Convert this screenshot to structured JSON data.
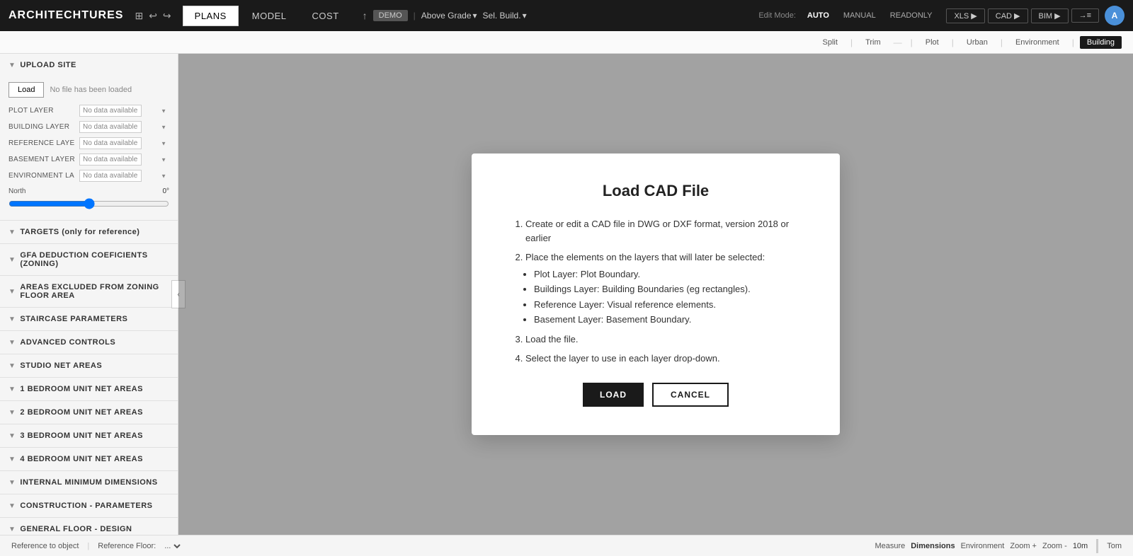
{
  "app": {
    "logo": "ARCHITECHTURES",
    "nav_icons": [
      "grid-icon",
      "undo-icon",
      "redo-icon"
    ]
  },
  "top_nav": {
    "tabs": [
      {
        "label": "PLANS",
        "active": true
      },
      {
        "label": "MODEL",
        "active": false
      },
      {
        "label": "COST",
        "active": false
      }
    ],
    "demo_badge": "DEMO",
    "pipe_sep": "|",
    "above_grade": "Above Grade",
    "sel_build": "Sel. Build.",
    "edit_mode_label": "Edit Mode:",
    "edit_modes": [
      "AUTO",
      "MANUAL",
      "READONLY"
    ],
    "active_edit_mode": "AUTO",
    "export_btns": [
      "XLS",
      "CAD",
      "BIM",
      "→≡"
    ],
    "user_initial": "A"
  },
  "second_bar": {
    "view_tabs": [
      {
        "label": "Split"
      },
      {
        "label": "Trim"
      },
      {
        "label": "Plot"
      },
      {
        "label": "Urban"
      },
      {
        "label": "Environment"
      },
      {
        "label": "Building",
        "active": true
      }
    ]
  },
  "sidebar": {
    "sections": [
      {
        "id": "upload-site",
        "label": "UPLOAD SITE",
        "expanded": true
      },
      {
        "id": "targets",
        "label": "TARGETS (only for reference)",
        "expanded": false
      },
      {
        "id": "gfa",
        "label": "GFA DEDUCTION COEFICIENTS (ZONING)",
        "expanded": false
      },
      {
        "id": "areas-excluded",
        "label": "AREAS EXCLUDED FROM ZONING FLOOR AREA",
        "expanded": false
      },
      {
        "id": "staircase",
        "label": "STAIRCASE PARAMETERS",
        "expanded": false
      },
      {
        "id": "advanced-controls",
        "label": "ADVANCED CONTROLS",
        "expanded": false
      },
      {
        "id": "studio",
        "label": "STUDIO NET AREAS",
        "expanded": false
      },
      {
        "id": "1bed",
        "label": "1 BEDROOM UNIT NET AREAS",
        "expanded": false
      },
      {
        "id": "2bed",
        "label": "2 BEDROOM UNIT NET AREAS",
        "expanded": false
      },
      {
        "id": "3bed",
        "label": "3 BEDROOM UNIT NET AREAS",
        "expanded": false
      },
      {
        "id": "4bed",
        "label": "4 BEDROOM UNIT NET AREAS",
        "expanded": false
      },
      {
        "id": "internal-min",
        "label": "INTERNAL MINIMUM DIMENSIONS",
        "expanded": false
      },
      {
        "id": "construction",
        "label": "CONSTRUCTION - PARAMETERS",
        "expanded": false
      },
      {
        "id": "general-floor",
        "label": "GENERAL FLOOR - DESIGN",
        "expanded": false
      }
    ],
    "upload": {
      "load_btn": "Load",
      "no_file": "No file has been loaded",
      "layers": [
        {
          "label": "PLOT LAYER",
          "value": "No data available"
        },
        {
          "label": "BUILDING LAYER",
          "value": "No data available"
        },
        {
          "label": "REFERENCE LAYE",
          "value": "No data available"
        },
        {
          "label": "BASEMENT LAYER",
          "value": "No data available"
        },
        {
          "label": "ENVIRONMENT LA",
          "value": "No data available"
        }
      ],
      "north_label": "North",
      "north_value": "0°",
      "north_slider_value": 0
    }
  },
  "modal": {
    "title": "Load CAD File",
    "instructions": [
      {
        "text": "Create or edit a CAD file in DWG or DXF format, version 2018 or earlier",
        "sub_items": []
      },
      {
        "text": "Place the elements on the layers that will later be selected:",
        "sub_items": [
          "Plot Layer: Plot Boundary.",
          "Buildings Layer: Building Boundaries (eg rectangles).",
          "Reference Layer: Visual reference elements.",
          "Basement Layer: Basement Boundary."
        ]
      },
      {
        "text": "Load the file.",
        "sub_items": []
      },
      {
        "text": "Select the layer to use in each layer drop-down.",
        "sub_items": []
      }
    ],
    "btn_load": "LOAD",
    "btn_cancel": "CANCEL"
  },
  "bottom_bar": {
    "ref_to_object": "Reference to object",
    "ref_floor_label": "Reference Floor:",
    "ref_floor_value": "...",
    "measure_label": "Measure",
    "dimensions": "Dimensions",
    "environment": "Environment",
    "zoom_in": "Zoom +",
    "zoom_out": "Zoom -",
    "zoom_level": "10m",
    "user_name": "Tom"
  },
  "colors": {
    "active_tab_bg": "#1a1a1a",
    "active_tab_color": "#ffffff",
    "load_btn_bg": "#1a1a1a",
    "cancel_btn_border": "#1a1a1a",
    "building_tab_active": "#1a1a1a"
  }
}
